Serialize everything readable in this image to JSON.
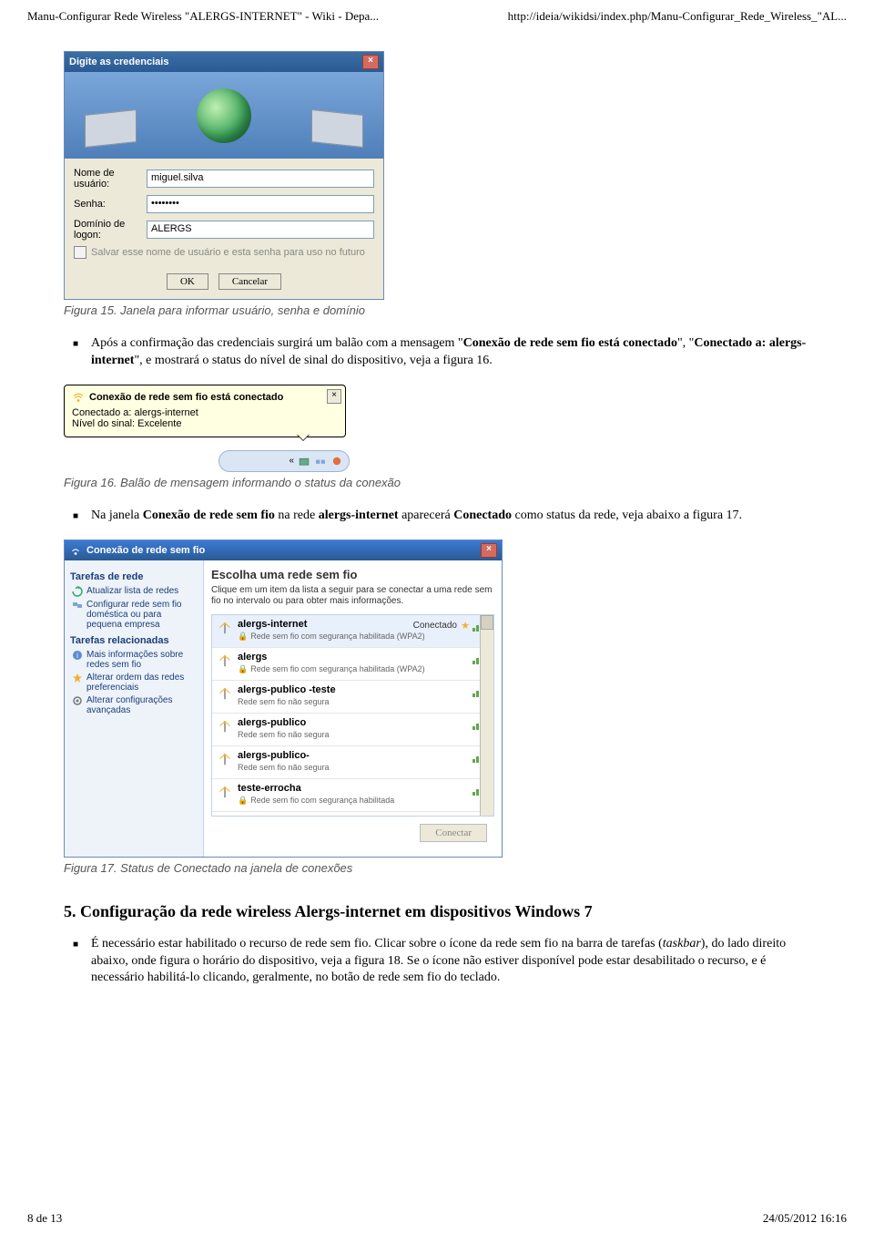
{
  "header": {
    "left": "Manu-Configurar Rede Wireless \"ALERGS-INTERNET\" - Wiki - Depa...",
    "right": "http://ideia/wikidsi/index.php/Manu-Configurar_Rede_Wireless_\"AL..."
  },
  "fig15": {
    "title": "Digite as credenciais",
    "user_label": "Nome de usuário:",
    "user_value": "miguel.silva",
    "pass_label": "Senha:",
    "pass_value": "••••••••",
    "domain_label": "Domínio de logon:",
    "domain_value": "ALERGS",
    "checkbox": "Salvar esse nome de usuário e esta senha para uso no futuro",
    "ok": "OK",
    "cancel": "Cancelar",
    "caption": "Figura 15. Janela para informar usuário, senha e domínio"
  },
  "bullet1_a": "Após a confirmação das credenciais surgirá um balão com a mensagem \"",
  "bullet1_b": "Conexão de rede sem fio está conectado",
  "bullet1_c": "\", \"",
  "bullet1_d": "Conectado a: alergs-internet",
  "bullet1_e": "\", e mostrará o status do nível de sinal do dispositivo, veja a figura 16.",
  "fig16": {
    "title": "Conexão de rede sem fio está conectado",
    "line1": "Conectado a: alergs-internet",
    "line2": "Nível do sinal: Excelente",
    "caption": "Figura 16. Balão de mensagem informando o status da conexão"
  },
  "bullet2_a": "Na janela ",
  "bullet2_b": "Conexão de rede sem fio",
  "bullet2_c": " na rede ",
  "bullet2_d": "alergs-internet",
  "bullet2_e": " aparecerá ",
  "bullet2_f": "Conectado",
  "bullet2_g": " como status da rede, veja abaixo a figura 17.",
  "fig17": {
    "window_title": "Conexão de rede sem fio",
    "side": {
      "g1": "Tarefas de rede",
      "i1": "Atualizar lista de redes",
      "i2": "Configurar rede sem fio doméstica ou para pequena empresa",
      "g2": "Tarefas relacionadas",
      "i3": "Mais informações sobre redes sem fio",
      "i4": "Alterar ordem das redes preferenciais",
      "i5": "Alterar configurações avançadas"
    },
    "main_heading": "Escolha uma rede sem fio",
    "main_instr": "Clique em um item da lista a seguir para se conectar a uma rede sem fio no intervalo ou para obter mais informações.",
    "status_connected": "Conectado",
    "nets": [
      {
        "name": "alergs-internet",
        "sub": "Rede sem fio com segurança habilitada (WPA2)",
        "status": true,
        "star": true
      },
      {
        "name": "alergs",
        "sub": "Rede sem fio com segurança habilitada (WPA2)"
      },
      {
        "name": "alergs-publico -teste",
        "sub": "Rede sem fio não segura"
      },
      {
        "name": "alergs-publico",
        "sub": "Rede sem fio não segura"
      },
      {
        "name": "alergs-publico-",
        "sub": "Rede sem fio não segura"
      },
      {
        "name": "teste-errocha",
        "sub": "Rede sem fio com segurança habilitada"
      }
    ],
    "connect_btn": "Conectar",
    "caption": "Figura 17. Status de Conectado na janela de conexões"
  },
  "section5": "5. Configuração da rede wireless Alergs-internet em dispositivos Windows 7",
  "bullet3_a": "É necessário estar habilitado o recurso de rede sem fio. Clicar sobre o ícone da rede sem fio na barra de tarefas (",
  "bullet3_b": "taskbar",
  "bullet3_c": "), do lado direito abaixo, onde figura o horário do dispositivo, veja a figura 18. Se o ícone não estiver disponível pode estar desabilitado o recurso, e é necessário habilitá-lo clicando, geralmente, no botão de rede sem fio do teclado.",
  "footer": {
    "left": "8 de 13",
    "right": "24/05/2012 16:16"
  }
}
